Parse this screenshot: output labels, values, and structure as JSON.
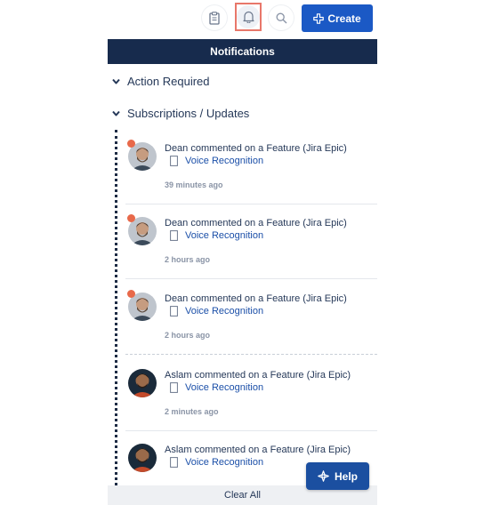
{
  "toolbar": {
    "icons": [
      "clipboard-icon",
      "bell-icon",
      "search-icon"
    ],
    "create_label": "Create"
  },
  "header": {
    "title": "Notifications"
  },
  "sections": {
    "action_required": "Action Required",
    "subscriptions": "Subscriptions / Updates"
  },
  "notifications": [
    {
      "title": "Dean commented on a Feature (Jira Epic)",
      "link": "Voice Recognition",
      "time": "39 minutes ago",
      "unread": true,
      "avatar": "dean"
    },
    {
      "title": "Dean commented on a Feature (Jira Epic)",
      "link": "Voice Recognition",
      "time": "2 hours ago",
      "unread": true,
      "avatar": "dean"
    },
    {
      "title": "Dean commented on a Feature (Jira Epic)",
      "link": "Voice Recognition",
      "time": "2 hours ago",
      "unread": true,
      "avatar": "dean"
    },
    {
      "title": "Aslam commented on a Feature (Jira Epic)",
      "link": "Voice Recognition",
      "time": "2 minutes ago",
      "unread": false,
      "avatar": "aslam"
    },
    {
      "title": "Aslam commented on a Feature (Jira Epic)",
      "link": "Voice Recognition",
      "time": "",
      "unread": false,
      "avatar": "aslam"
    }
  ],
  "footer": {
    "clear_all": "Clear All"
  },
  "help": {
    "label": "Help"
  },
  "colors": {
    "primary": "#1b59c5",
    "header": "#172b4d",
    "unread": "#e8694a",
    "link": "#1b4fa8"
  }
}
